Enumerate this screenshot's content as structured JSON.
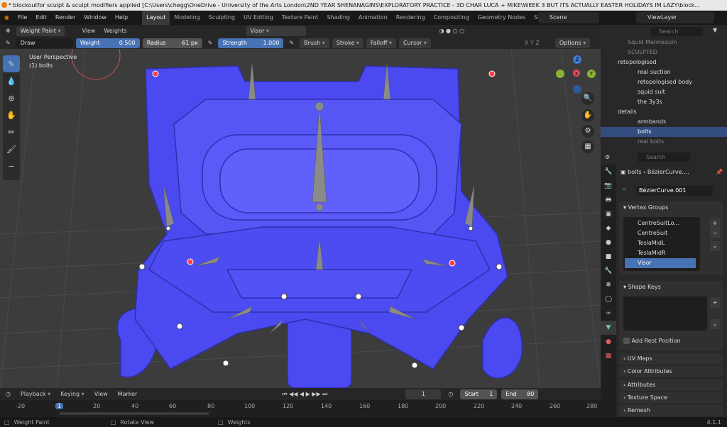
{
  "title": "* blockoutfor sculpt & sculpt modifiers applied [C:\\Users\\chegg\\OneDrive - University of the Arts London\\2ND YEAR SHENANAGINS\\EXPLORATORY PRACTICE - 3D CHAR LUCA + MIKE\\WEEK 3 BUT ITS ACTUALLY EASTER HOLIDAYS IM LAZY\\block...",
  "menu": [
    "File",
    "Edit",
    "Render",
    "Window",
    "Help"
  ],
  "workspaces": [
    "Layout",
    "Modeling",
    "Sculpting",
    "UV Editing",
    "Texture Paint",
    "Shading",
    "Animation",
    "Rendering",
    "Compositing",
    "Geometry Nodes",
    "Scriptin"
  ],
  "scene": "Scene",
  "view_layer": "ViewLayer",
  "header": {
    "mode": "Weight Paint",
    "view": "View",
    "weights": "Weights",
    "vgroup": "Visor"
  },
  "tool_settings": {
    "brush": "Draw",
    "weight_label": "Weight",
    "weight": "0.500",
    "radius_label": "Radius",
    "radius": "61 px",
    "strength_label": "Strength",
    "strength": "1.000",
    "brush_menu": "Brush",
    "stroke": "Stroke",
    "falloff": "Falloff",
    "cursor": "Cursor",
    "axes": "X  Y  Z",
    "options": "Options"
  },
  "viewport": {
    "perspective": "User Perspective",
    "object": "(1) bolts",
    "gizmo": {
      "x": "X",
      "y": "Y",
      "z": "Z"
    }
  },
  "outliner": {
    "search": "Search",
    "rows": [
      {
        "label": "Squid Mannequin",
        "depth": 2,
        "selected": false
      },
      {
        "label": "SCULPTED",
        "depth": 2,
        "selected": false
      },
      {
        "label": "retopologised",
        "depth": 1,
        "selected": false
      },
      {
        "label": "real suction",
        "depth": 2,
        "selected": false
      },
      {
        "label": "retopologised body",
        "depth": 2,
        "selected": false
      },
      {
        "label": "squid suit",
        "depth": 2,
        "selected": false
      },
      {
        "label": "the 3y3s",
        "depth": 2,
        "selected": false
      },
      {
        "label": "details",
        "depth": 1,
        "selected": false
      },
      {
        "label": "armbands",
        "depth": 2,
        "selected": false
      },
      {
        "label": "bolts",
        "depth": 2,
        "selected": true
      },
      {
        "label": "real bolts",
        "depth": 2,
        "selected": false
      }
    ]
  },
  "properties": {
    "search": "Search",
    "breadcrumb_obj": "bolts",
    "breadcrumb_data": "BézierCurve....",
    "data_name": "BézierCurve.001",
    "vertex_groups_title": "Vertex Groups",
    "vertex_groups": [
      "CentreSuitLo...",
      "CentreSuit",
      "TeslaMidL",
      "TeslaMidR",
      "Visor"
    ],
    "shape_keys_title": "Shape Keys",
    "add_rest_position": "Add Rest Position",
    "collapsed": [
      "UV Maps",
      "Color Attributes",
      "Attributes",
      "Texture Space",
      "Remesh"
    ]
  },
  "timeline": {
    "playback": "Playback",
    "keying": "Keying",
    "view": "View",
    "marker": "Marker",
    "current": "1",
    "start_label": "Start",
    "start": "1",
    "end_label": "End",
    "end": "80",
    "ticks": [
      "-20",
      "1",
      "20",
      "40",
      "60",
      "80",
      "100",
      "120",
      "140",
      "160",
      "180",
      "200",
      "220",
      "240",
      "260",
      "280"
    ]
  },
  "status": {
    "left": "Weight Paint",
    "mid": "Rotate View",
    "right": "Weights",
    "version": "4.1.1"
  },
  "colors": {
    "mesh": "#4a4af0",
    "accent": "#4772b3"
  }
}
